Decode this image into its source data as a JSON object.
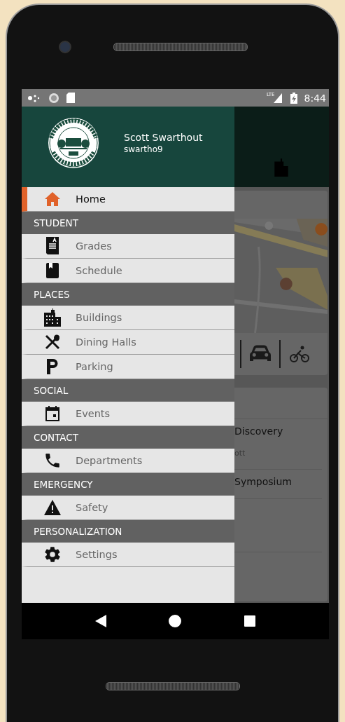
{
  "status_bar": {
    "network": "LTE",
    "time": "8:44"
  },
  "drawer": {
    "user": {
      "name": "Scott Swarthout",
      "username": "swartho9"
    },
    "sections": [
      {
        "items": [
          {
            "label": "Home",
            "selected": true
          }
        ]
      },
      {
        "title": "STUDENT",
        "items": [
          {
            "label": "Grades",
            "selected": false
          },
          {
            "label": "Schedule",
            "selected": false
          }
        ]
      },
      {
        "title": "PLACES",
        "items": [
          {
            "label": "Buildings",
            "selected": false
          },
          {
            "label": "Dining Halls",
            "selected": false
          },
          {
            "label": "Parking",
            "selected": false
          }
        ]
      },
      {
        "title": "SOCIAL",
        "items": [
          {
            "label": "Events",
            "selected": false
          }
        ]
      },
      {
        "title": "CONTACT",
        "items": [
          {
            "label": "Departments",
            "selected": false
          }
        ]
      },
      {
        "title": "EMERGENCY",
        "items": [
          {
            "label": "Safety",
            "selected": false
          }
        ]
      },
      {
        "title": "PERSONALIZATION",
        "items": [
          {
            "label": "Settings",
            "selected": false
          }
        ]
      }
    ]
  },
  "background": {
    "events": [
      "Discovery",
      "ott",
      "Symposium"
    ]
  }
}
